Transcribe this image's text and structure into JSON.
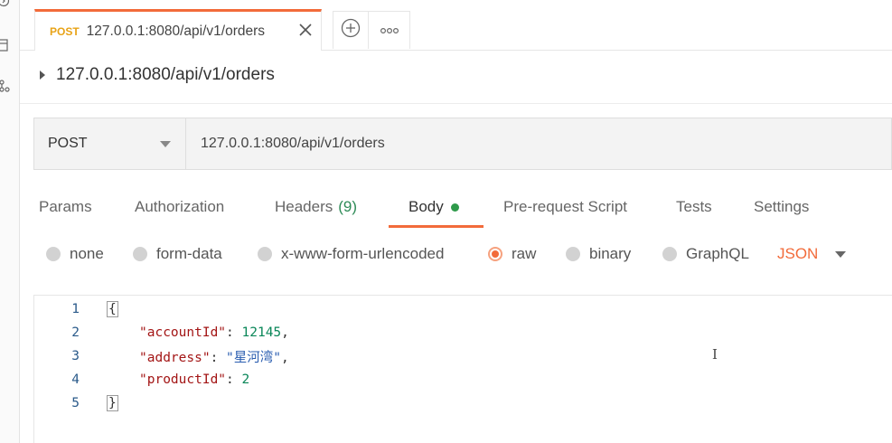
{
  "rail": {
    "icons": [
      "history-icon",
      "collections-icon",
      "api-icon"
    ]
  },
  "tabs": {
    "active": {
      "method": "POST",
      "title": "127.0.0.1:8080/api/v1/orders"
    },
    "new_tab_icon": "plus-icon",
    "more_icon": "more-icon"
  },
  "breadcrumb": {
    "title": "127.0.0.1:8080/api/v1/orders"
  },
  "request": {
    "method": "POST",
    "url": "127.0.0.1:8080/api/v1/orders"
  },
  "request_tabs": [
    {
      "label": "Params"
    },
    {
      "label": "Authorization"
    },
    {
      "label": "Headers",
      "count": "(9)"
    },
    {
      "label": "Body",
      "active": true
    },
    {
      "label": "Pre-request Script"
    },
    {
      "label": "Tests"
    },
    {
      "label": "Settings"
    }
  ],
  "body_types": [
    {
      "label": "none"
    },
    {
      "label": "form-data"
    },
    {
      "label": "x-www-form-urlencoded"
    },
    {
      "label": "raw",
      "selected": true
    },
    {
      "label": "binary"
    },
    {
      "label": "GraphQL"
    }
  ],
  "language": "JSON",
  "editor": {
    "line_numbers": [
      "1",
      "2",
      "3",
      "4",
      "5"
    ],
    "open_brace": "{",
    "close_brace": "}",
    "fields": [
      {
        "key": "\"accountId\"",
        "value": "12145",
        "sep": ",",
        "kind": "number"
      },
      {
        "key": "\"address\"",
        "value": "\"星河湾\"",
        "sep": ",",
        "kind": "string"
      },
      {
        "key": "\"productId\"",
        "value": "2",
        "sep": "",
        "kind": "number"
      }
    ],
    "text_cursor": "I"
  },
  "colors": {
    "accent": "#f26b3a",
    "post_method": "#e8a317",
    "headers_count": "#2e8b57",
    "body_dot": "#2e9a4a"
  }
}
